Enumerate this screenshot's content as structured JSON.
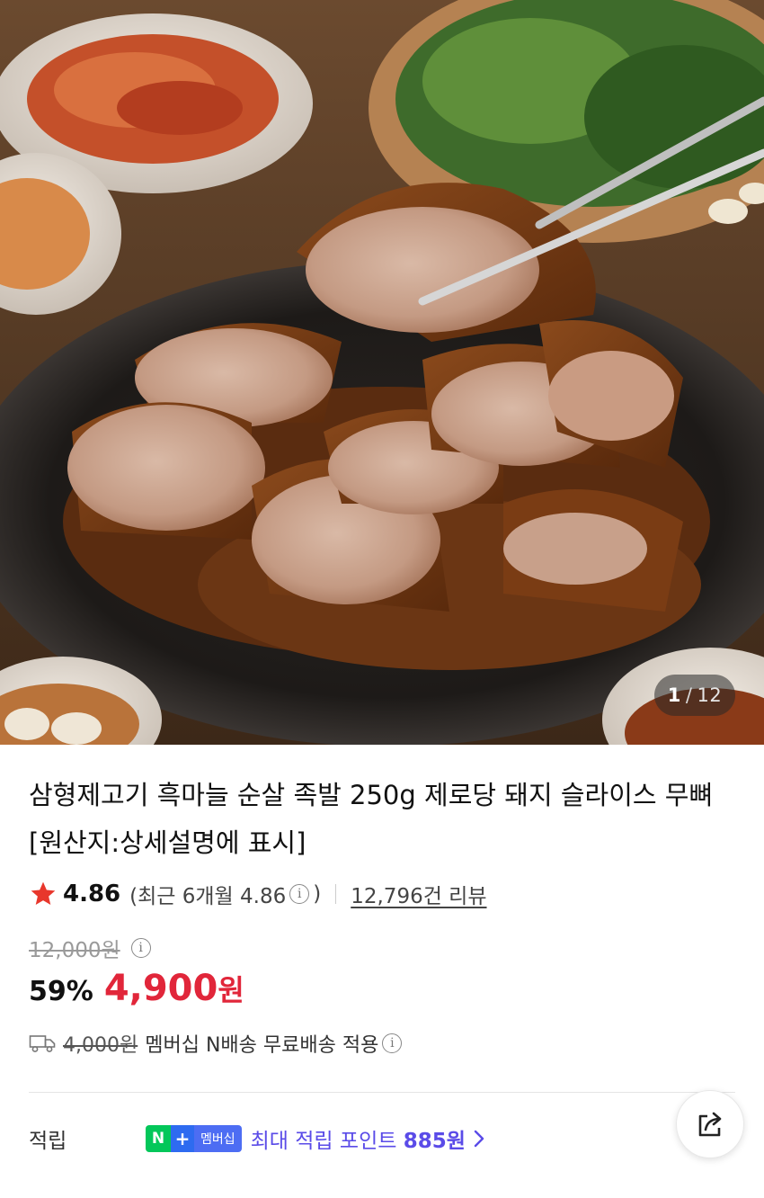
{
  "gallery": {
    "current": "1",
    "separator": "/",
    "total": "12",
    "image_alt": "jokbal-product-photo"
  },
  "product": {
    "title": "삼형제고기 흑마늘 순살 족발 250g 제로당 돼지 슬라이스 무뼈 [원산지:상세설명에 표시]"
  },
  "rating": {
    "score": "4.86",
    "recent_text": "(최근 6개월 4.86",
    "recent_close": ")",
    "review_count": "12,796건 리뷰",
    "star_color": "#e8372c"
  },
  "price": {
    "original": "12,000원",
    "discount": "59%",
    "sale_amount": "4,900",
    "sale_unit": "원",
    "sale_color": "#e1263a"
  },
  "shipping": {
    "original_fee": "4,000원",
    "text": "멤버십 N배송 무료배송 적용"
  },
  "points": {
    "label": "적립",
    "badge_n": "N",
    "badge_plus": "+",
    "badge_membership": "멤버십",
    "text_prefix": "최대 적립 포인트 ",
    "amount": "885원",
    "accent_color": "#5a4be8"
  },
  "icons": {
    "info": "i",
    "star": "star-icon",
    "truck": "truck-icon",
    "share": "share-icon",
    "chevron": "chevron-right-icon"
  }
}
